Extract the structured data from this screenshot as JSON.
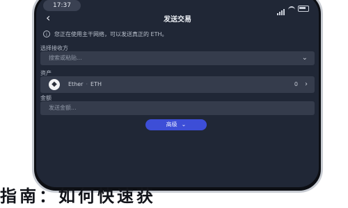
{
  "status": {
    "time": "17:37"
  },
  "header": {
    "title": "发送交易",
    "back_icon": "arrow-left-icon"
  },
  "notice": {
    "text": "您正在使用主干网络，可以发送真正的 ETH。",
    "icon": "info-icon"
  },
  "form": {
    "network_label": "选择接收方",
    "network_placeholder": "搜索或粘贴...",
    "asset_label": "资产",
    "asset_name": "Ether",
    "asset_symbol": "ETH",
    "asset_balance": "0",
    "amount_label": "金额",
    "amount_placeholder": "发送金额..."
  },
  "button": {
    "more_label": "高级"
  },
  "banner": {
    "text": "指南：如何快速获"
  },
  "colors": {
    "screen_bg": "#202736",
    "field_bg": "#353c4c",
    "accent": "#3d4ed7"
  }
}
